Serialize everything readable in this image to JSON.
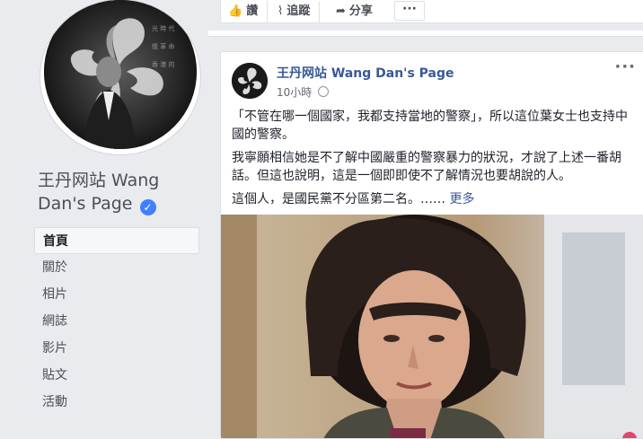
{
  "page": {
    "name": "王丹网站 Wang Dan's Page",
    "verified_icon": "check-badge-icon"
  },
  "sidebar": {
    "items": [
      {
        "label": "首頁",
        "active": true
      },
      {
        "label": "關於",
        "active": false
      },
      {
        "label": "相片",
        "active": false
      },
      {
        "label": "網誌",
        "active": false
      },
      {
        "label": "影片",
        "active": false
      },
      {
        "label": "貼文",
        "active": false
      },
      {
        "label": "活動",
        "active": false
      }
    ]
  },
  "actions": {
    "like": {
      "label": "讚",
      "icon": "thumbs-up-icon"
    },
    "follow": {
      "label": "追蹤",
      "icon": "rss-icon"
    },
    "share": {
      "label": "分享",
      "icon": "share-arrow-icon"
    },
    "more": "···"
  },
  "post": {
    "author": "王丹网站 Wang Dan's Page",
    "time": "10小時",
    "options": "···",
    "paragraphs": [
      "「不管在哪一個國家，我都支持當地的警察」，所以這位葉女士也支持中國的警察。",
      "我寧願相信她是不了解中國嚴重的警察暴力的狀況，才說了上述一番胡話。但這也說明，這是一個即即使不了解情況也要胡說的人。"
    ],
    "last_line": "這個人，是國民黨不分區第二名。……",
    "see_more": "更多"
  },
  "colors": {
    "link": "#385898",
    "background": "#e9ebee",
    "verified": "#4080ff"
  }
}
